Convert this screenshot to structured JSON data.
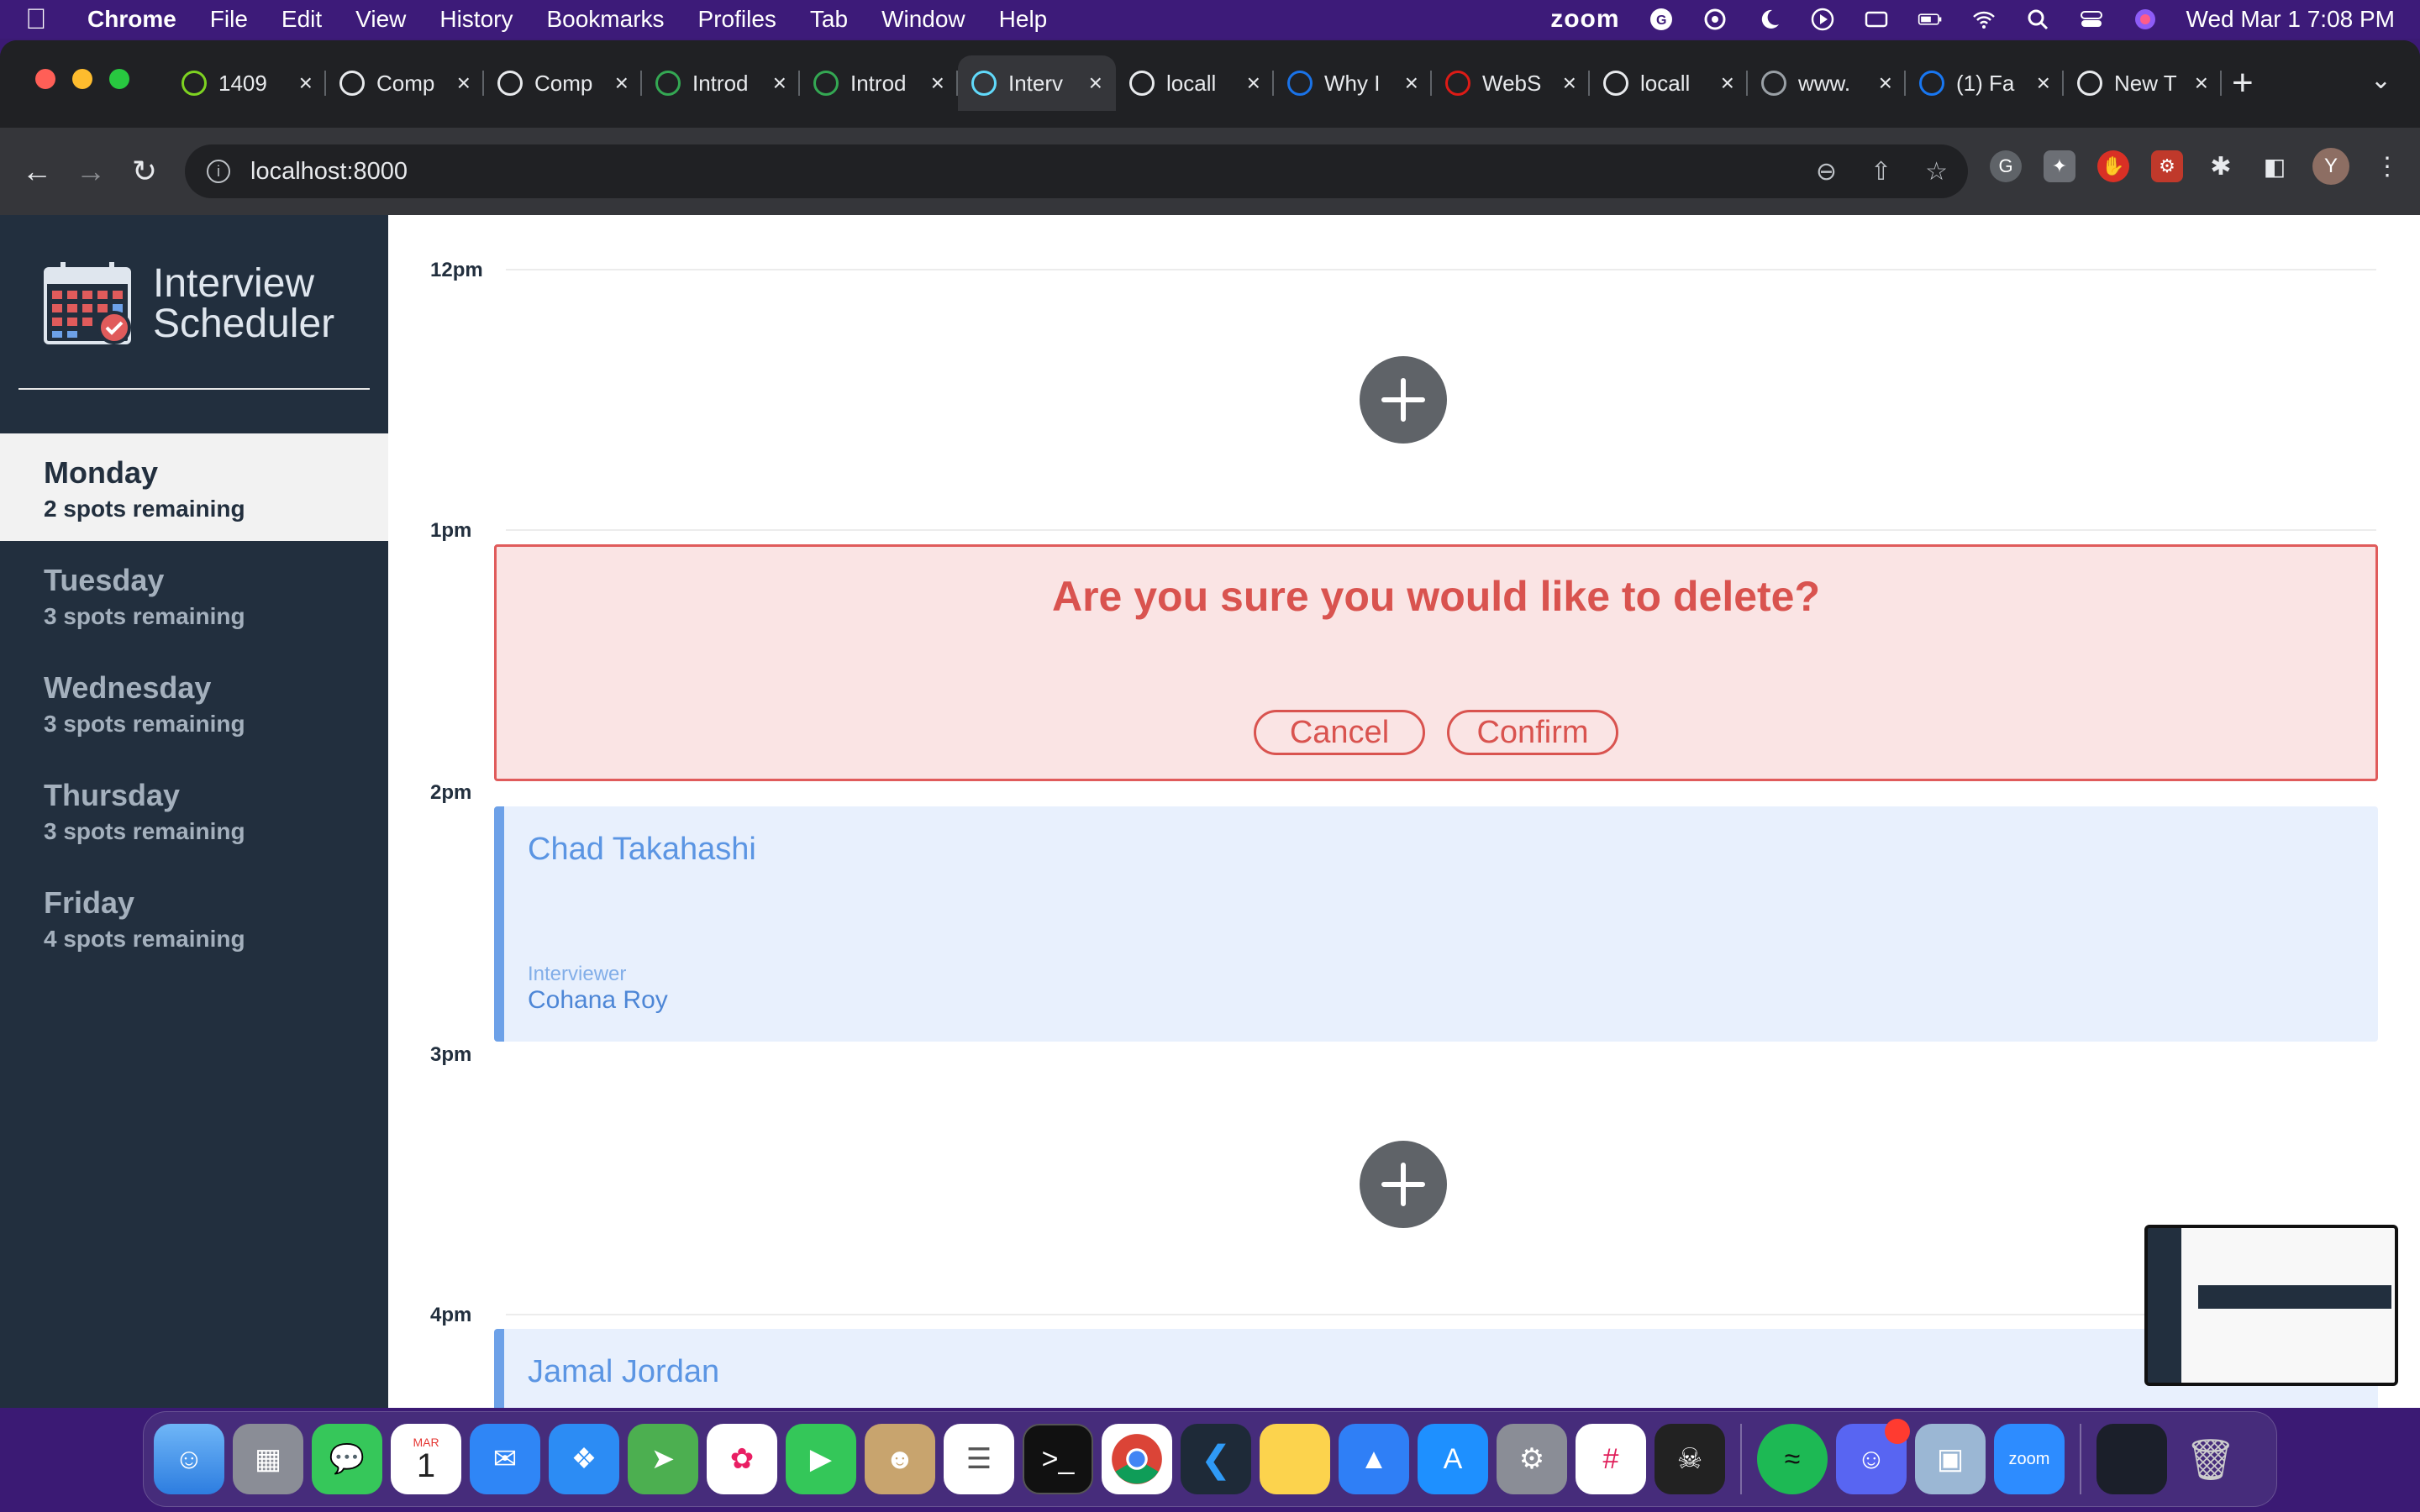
{
  "menubar": {
    "app_name": "Chrome",
    "items": [
      "File",
      "Edit",
      "View",
      "History",
      "Bookmarks",
      "Profiles",
      "Tab",
      "Window",
      "Help"
    ],
    "zoom": "zoom",
    "datetime": "Wed Mar 1  7:08 PM"
  },
  "browser": {
    "tabs": [
      {
        "title": "1409",
        "icon": "smiley-icon",
        "color": "#7ed321"
      },
      {
        "title": "Comp",
        "icon": "circle-icon",
        "color": "#e8eaed"
      },
      {
        "title": "Comp",
        "icon": "circle-icon",
        "color": "#e8eaed"
      },
      {
        "title": "Introd",
        "icon": "loading-icon",
        "color": "#34a853"
      },
      {
        "title": "Introd",
        "icon": "loading-icon",
        "color": "#34a853"
      },
      {
        "title": "Interv",
        "icon": "react-icon",
        "color": "#61dafb",
        "active": true
      },
      {
        "title": "locall",
        "icon": "globe-icon",
        "color": "#e8eaed"
      },
      {
        "title": "Why I",
        "icon": "es-icon",
        "color": "#1a73e8"
      },
      {
        "title": "WebS",
        "icon": "angular-icon",
        "color": "#dd1b16"
      },
      {
        "title": "locall",
        "icon": "globe-icon",
        "color": "#e8eaed"
      },
      {
        "title": "www.",
        "icon": "globe-icon",
        "color": "#9aa0a6"
      },
      {
        "title": "(1) Fa",
        "icon": "facebook-icon",
        "color": "#1877f2"
      },
      {
        "title": "New T",
        "icon": "chrome-icon",
        "color": "#e8eaed"
      }
    ],
    "url": "localhost:8000",
    "profile_initial": "Y"
  },
  "app": {
    "logo_text_line1": "Interview",
    "logo_text_line2": "Scheduler",
    "days": [
      {
        "name": "Monday",
        "spots": "2 spots remaining",
        "selected": true
      },
      {
        "name": "Tuesday",
        "spots": "3 spots remaining"
      },
      {
        "name": "Wednesday",
        "spots": "3 spots remaining"
      },
      {
        "name": "Thursday",
        "spots": "3 spots remaining"
      },
      {
        "name": "Friday",
        "spots": "4 spots remaining"
      }
    ],
    "times": [
      "12pm",
      "1pm",
      "2pm",
      "3pm",
      "4pm"
    ],
    "delete_confirm": {
      "message": "Are you sure you would like to delete?",
      "cancel": "Cancel",
      "confirm": "Confirm"
    },
    "appointments": [
      {
        "student": "Chad Takahashi",
        "interviewer_label": "Interviewer",
        "interviewer": "Cohana Roy"
      },
      {
        "student": "Jamal Jordan"
      }
    ]
  },
  "dock": {
    "calendar_month": "MAR",
    "calendar_day": "1",
    "zoom_label": "zoom"
  },
  "colors": {
    "sidebar": "#222f3e",
    "danger": "#d9534f",
    "appointment_bg": "#e8f0fd",
    "appointment_accent": "#6da1e8"
  }
}
